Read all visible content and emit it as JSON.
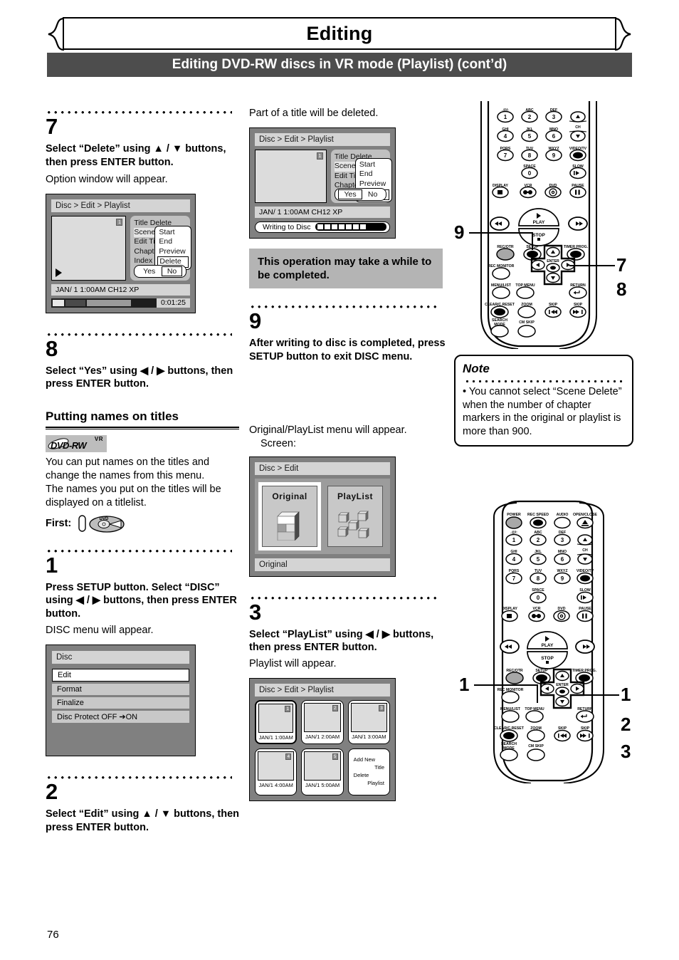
{
  "header": {
    "title": "Editing",
    "subtitle": "Editing DVD-RW discs in VR mode (Playlist) (cont’d)"
  },
  "page_number": "76",
  "left_column": {
    "step7": {
      "number": "7",
      "instruction": "Select “Delete” using ▲ / ▼ buttons, then press ENTER button.",
      "note": "Option window will appear."
    },
    "osd_delete": {
      "breadcrumb": "Disc > Edit > Playlist",
      "thumb_badge": "1",
      "menu_items": [
        "Title Delete",
        "Scene Delete",
        "Edit Title Name",
        "Chapter Mark",
        "Index Picture"
      ],
      "menu_selected": "Scene Delete",
      "popup_items": [
        "Start",
        "End",
        "Preview",
        "Delete"
      ],
      "popup_selected": "Delete",
      "yes_label": "Yes",
      "no_label": "No",
      "status": "JAN/ 1   1:00AM  CH12     XP",
      "time": "0:01:25"
    },
    "step8": {
      "number": "8",
      "instruction": "Select “Yes” using ◀ / ▶ buttons, then press ENTER button."
    },
    "section": {
      "heading": "Putting names on titles",
      "logo_vr": "VR",
      "logo_name": "DVD-RW",
      "body1": "You can put names on the titles and change the names from this menu.",
      "body2": "The names you put on the titles will be displayed on a titlelist.",
      "first_label": "First:",
      "first_icon": "dvd-disc-insert-icon"
    },
    "step1": {
      "number": "1",
      "instruction": "Press SETUP button. Select “DISC” using ◀ / ▶ buttons, then press ENTER button.",
      "note": "DISC menu will appear."
    },
    "osd_disc": {
      "title": "Disc",
      "rows": [
        "Edit",
        "Format",
        "Finalize",
        "Disc Protect OFF ➔ON"
      ],
      "selected": "Edit"
    },
    "step2": {
      "number": "2",
      "instruction": "Select “Edit” using ▲ / ▼ buttons, then press ENTER button."
    }
  },
  "middle_column": {
    "intro": "Part of a title will be deleted.",
    "osd_writing": {
      "breadcrumb": "Disc > Edit > Playlist",
      "thumb_badge": "1",
      "menu_items": [
        "Title Delete",
        "Scene Delete",
        "Edit Title Name",
        "Chapter Mark",
        "Index Picture"
      ],
      "menu_selected": "Scene Delete",
      "popup_items": [
        "Start",
        "End",
        "Preview",
        "Delete"
      ],
      "popup_selected": "Delete",
      "yes_label": "Yes",
      "no_label": "No",
      "status": "JAN/ 1   1:00AM  CH12     XP",
      "writing_label": "Writing to Disc"
    },
    "callout_box": "This operation may take a while to be completed.",
    "step9": {
      "number": "9",
      "instruction": "After writing to disc is completed, press SETUP button to exit DISC menu."
    },
    "op_intro1": "Original/PlayList menu will appear.",
    "op_intro2": "Screen:",
    "osd_original": {
      "breadcrumb": "Disc > Edit",
      "tile1": "Original",
      "tile2": "PlayList",
      "selected": "Original",
      "footer": "Original"
    },
    "step3": {
      "number": "3",
      "instruction": "Select “PlayList” using ◀ / ▶ buttons, then press ENTER button.",
      "note": "Playlist will appear."
    },
    "osd_playlist": {
      "breadcrumb": "Disc > Edit > Playlist",
      "cells": [
        {
          "index": "1",
          "caption": "JAN/1  1:00AM",
          "selected": true
        },
        {
          "index": "2",
          "caption": "JAN/1  2:00AM",
          "selected": false
        },
        {
          "index": "3",
          "caption": "JAN/1  3:00AM",
          "selected": false
        },
        {
          "index": "4",
          "caption": "JAN/1  4:00AM",
          "selected": false
        },
        {
          "index": "5",
          "caption": "JAN/1  5:00AM",
          "selected": false
        }
      ],
      "menu_cell": [
        "Add  New",
        "Title",
        "Delete",
        "Playlist"
      ]
    }
  },
  "note": {
    "heading": "Note",
    "body": "• You cannot select “Scene Delete” when the number of chapter markers in the original or playlist is more than 900."
  },
  "remote_top": {
    "callouts": [
      "9",
      "7",
      "8"
    ],
    "keys": {
      "r1": [
        {
          "top": ".@/:",
          "label": "1"
        },
        {
          "top": "ABC",
          "label": "2"
        },
        {
          "top": "DEF",
          "label": "3"
        }
      ],
      "r2": [
        {
          "top": "GHI",
          "label": "4"
        },
        {
          "top": "JKL",
          "label": "5"
        },
        {
          "top": "MNO",
          "label": "6"
        }
      ],
      "r3": [
        {
          "top": "PQRS",
          "label": "7"
        },
        {
          "top": "TUV",
          "label": "8"
        },
        {
          "top": "WXYZ",
          "label": "9"
        }
      ],
      "r4": [
        {
          "top": "SPACE",
          "label": "0"
        }
      ],
      "ch": "CH",
      "video_tv": "VIDEO/TV",
      "slow": "SLOW",
      "r5": [
        "DISPLAY",
        "VCR",
        "DVD",
        "PAUSE"
      ],
      "play": "PLAY",
      "stop": "STOP",
      "r6": [
        "REC/OTR",
        "SETUP",
        "TIMER PROG."
      ],
      "r7": [
        "REC MONITOR",
        "ENTER"
      ],
      "r8": [
        "MENU/LIST",
        "TOP MENU",
        "RETURN"
      ],
      "r9": [
        "CLEAR/C.RESET",
        "ZOOM",
        "SKIP",
        "SKIP"
      ],
      "r10": [
        "SEARCH MODE",
        "CM SKIP"
      ]
    }
  },
  "remote_bottom": {
    "callouts": [
      "1",
      "1",
      "2",
      "3"
    ],
    "keys": {
      "r0": [
        "POWER",
        "REC SPEED",
        "AUDIO",
        "OPEN/CLOSE"
      ],
      "r1": [
        {
          "top": ".@/:",
          "label": "1"
        },
        {
          "top": "ABC",
          "label": "2"
        },
        {
          "top": "DEF",
          "label": "3"
        }
      ],
      "r2": [
        {
          "top": "GHI",
          "label": "4"
        },
        {
          "top": "JKL",
          "label": "5"
        },
        {
          "top": "MNO",
          "label": "6"
        }
      ],
      "r3": [
        {
          "top": "PQRS",
          "label": "7"
        },
        {
          "top": "TUV",
          "label": "8"
        },
        {
          "top": "WXYZ",
          "label": "9"
        }
      ],
      "r4": [
        {
          "top": "SPACE",
          "label": "0"
        }
      ],
      "ch": "CH",
      "video_tv": "VIDEO/TV",
      "slow": "SLOW",
      "r5": [
        "DISPLAY",
        "VCR",
        "DVD",
        "PAUSE"
      ],
      "play": "PLAY",
      "stop": "STOP",
      "r6": [
        "REC/OTR",
        "SETUP",
        "TIMER PROG."
      ],
      "r7": [
        "REC MONITOR",
        "ENTER"
      ],
      "r8": [
        "MENU/LIST",
        "TOP MENU",
        "RETURN"
      ],
      "r9": [
        "CLEAR/C.RESET",
        "ZOOM",
        "SKIP",
        "SKIP"
      ],
      "r10": [
        "SEARCH MODE",
        "CM SKIP"
      ]
    }
  }
}
